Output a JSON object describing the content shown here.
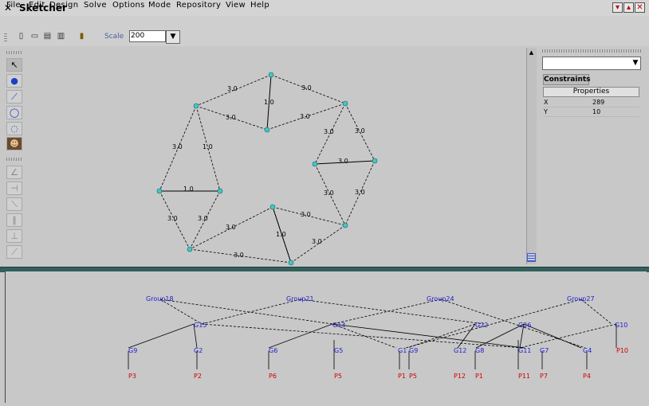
{
  "window": {
    "title": "Sketcher",
    "controls": [
      "minimize-icon",
      "maximize-icon",
      "close-icon"
    ]
  },
  "menu": [
    "File",
    "Edit",
    "Design",
    "Solve",
    "Options",
    "Mode",
    "Repository",
    "View",
    "Help"
  ],
  "toolbar": {
    "scale_label": "Scale",
    "scale_value": "200"
  },
  "palette": {
    "groups": [
      [
        "select-arrow-icon",
        "point-icon",
        "line-icon",
        "circle-icon",
        "arc-icon",
        "image-icon"
      ],
      [
        "angle-icon",
        "perpendicular-icon",
        "tangent-icon",
        "parallel-icon",
        "perpendicular-base-icon",
        "incidence-icon"
      ]
    ]
  },
  "canvas": {
    "edge_labels": [
      "3.0",
      "3.0",
      "1.0",
      "3.0",
      "3.0",
      "3.0",
      "3.0",
      "3.0",
      "1.0",
      "3.0",
      "3.0",
      "1.0",
      "3.0",
      "3.0",
      "3.0",
      "1.0",
      "3.0",
      "3.0",
      "3.0",
      "3.0"
    ]
  },
  "right_panel": {
    "combo_value": "",
    "tab": "Constraints",
    "properties_header": "Properties",
    "rows": [
      {
        "key": "X",
        "value": "289"
      },
      {
        "key": "Y",
        "value": "10"
      }
    ]
  },
  "tree": {
    "groups": [
      "Group18",
      "Group21",
      "Group24",
      "Group27"
    ],
    "mid_nodes": [
      "G15",
      "G13",
      "G22",
      "G26",
      "G10"
    ],
    "leaves": [
      "G9",
      "G2",
      "G6",
      "G5",
      "G1",
      "G9",
      "G12",
      "G8",
      "G11",
      "G7",
      "G4",
      "P10"
    ],
    "points": [
      "P3",
      "P2",
      "P6",
      "P5",
      "P1",
      "P5",
      "P12",
      "P1",
      "P11",
      "P7",
      "P4"
    ]
  },
  "colors": {
    "group_text": "#2020d0",
    "point_text": "#d00000",
    "node_fill": "#40c8c8"
  }
}
